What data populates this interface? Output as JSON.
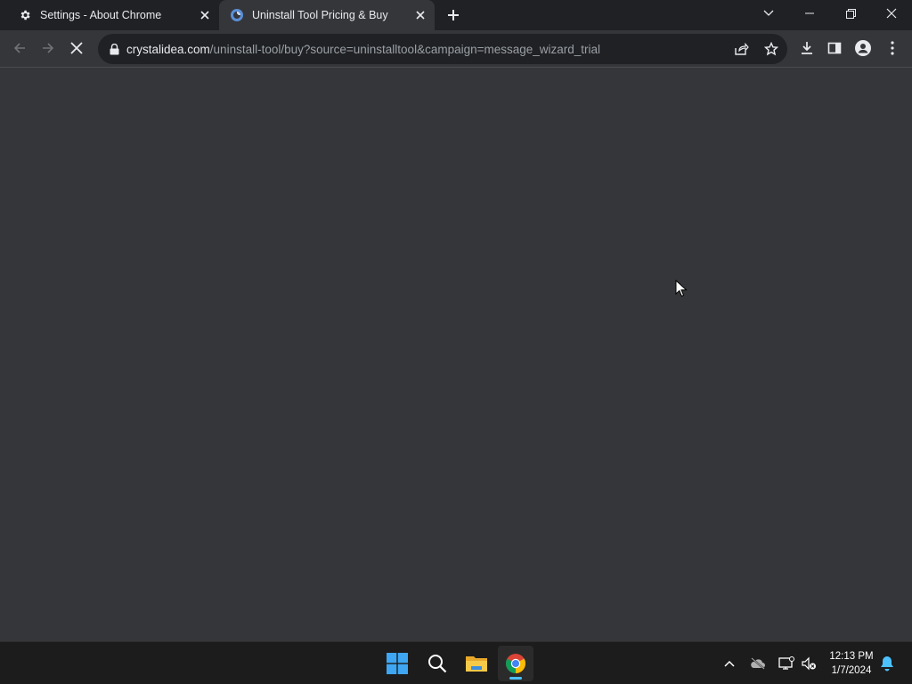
{
  "tabs": [
    {
      "title": "Settings - About Chrome",
      "icon": "gear-icon",
      "active": false
    },
    {
      "title": "Uninstall Tool Pricing & Buy",
      "icon": "crystalidea-favicon",
      "active": true
    }
  ],
  "address_bar": {
    "host": "crystalidea.com",
    "path": "/uninstall-tool/buy?source=uninstalltool&campaign=message_wizard_trial"
  },
  "page_state": "loading",
  "taskbar": {
    "apps": [
      "start-icon",
      "search-icon",
      "file-explorer-icon",
      "chrome-icon"
    ],
    "clock": {
      "time": "12:13 PM",
      "date": "1/7/2024"
    }
  },
  "colors": {
    "tab_strip": "#202124",
    "toolbar": "#35363a",
    "omnibox": "#202124",
    "taskbar": "#1c1c1c",
    "accent": "#4cc2ff"
  }
}
